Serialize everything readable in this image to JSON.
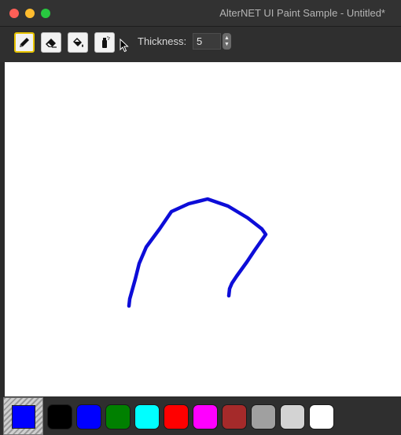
{
  "window": {
    "title": "AlterNET UI Paint Sample - Untitled*"
  },
  "toolbar": {
    "tools": [
      {
        "name": "pen",
        "icon": "pencil-icon",
        "selected": true
      },
      {
        "name": "eraser",
        "icon": "eraser-icon",
        "selected": false
      },
      {
        "name": "fill",
        "icon": "paint-bucket-icon",
        "selected": false
      },
      {
        "name": "airbrush",
        "icon": "spray-can-icon",
        "selected": false
      }
    ],
    "thickness_label": "Thickness:",
    "thickness_value": "5"
  },
  "canvas": {
    "stroke_color": "#0d0dd8"
  },
  "palette": {
    "current_color": "#0000ff",
    "swatches": [
      "#000000",
      "#0000ff",
      "#008000",
      "#00ffff",
      "#ff0000",
      "#ff00ff",
      "#a52a2a",
      "#a0a0a0",
      "#d3d3d3",
      "#ffffff"
    ]
  }
}
